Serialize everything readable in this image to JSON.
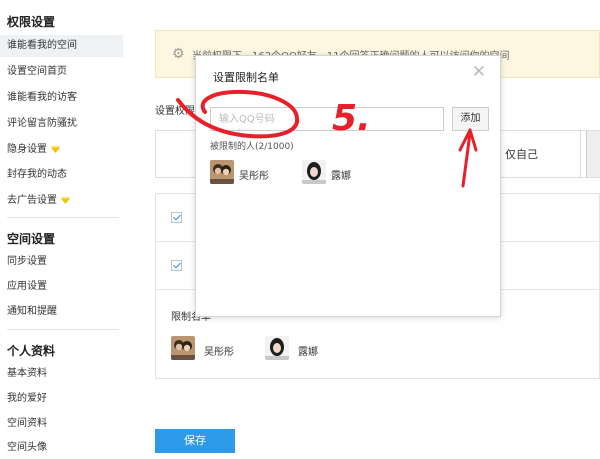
{
  "sidebar": {
    "sections": [
      {
        "title": "权限设置",
        "items": [
          {
            "label": "谁能看我的空间",
            "active": true,
            "vip": false
          },
          {
            "label": "设置空间首页",
            "active": false,
            "vip": false
          },
          {
            "label": "谁能看我的访客",
            "active": false,
            "vip": false
          },
          {
            "label": "评论留言防骚扰",
            "active": false,
            "vip": false
          },
          {
            "label": "隐身设置",
            "active": false,
            "vip": true
          },
          {
            "label": "封存我的动态",
            "active": false,
            "vip": false
          },
          {
            "label": "去广告设置",
            "active": false,
            "vip": true
          }
        ]
      },
      {
        "title": "空间设置",
        "items": [
          {
            "label": "同步设置"
          },
          {
            "label": "应用设置"
          },
          {
            "label": "通知和提醒"
          }
        ]
      },
      {
        "title": "个人资料",
        "items": [
          {
            "label": "基本资料"
          },
          {
            "label": "我的爱好"
          },
          {
            "label": "空间资料"
          },
          {
            "label": "空间头像"
          }
        ]
      }
    ]
  },
  "main": {
    "notice": "当前权限下，162个QQ好友、11个回答正确问题的人可以访问你的空间",
    "settings_label": "设置权限",
    "only_self_label": "仅自己",
    "limit_label": "限制名单",
    "restricted_users": [
      {
        "name": "吴彤彤"
      },
      {
        "name": "露娜"
      }
    ],
    "save_label": "保存"
  },
  "dialog": {
    "title": "设置限制名单",
    "input_placeholder": "输入QQ号码",
    "add_label": "添加",
    "count_label": "被限制的人(2/1000)",
    "users": [
      {
        "name": "吴彤彤"
      },
      {
        "name": "露娜"
      }
    ]
  },
  "annotation": {
    "text": "5.",
    "color": "#e8202a"
  },
  "colors": {
    "accent": "#2e9bea",
    "notice_bg": "#fdf7e1",
    "vip_diamond": "#f5c400"
  }
}
